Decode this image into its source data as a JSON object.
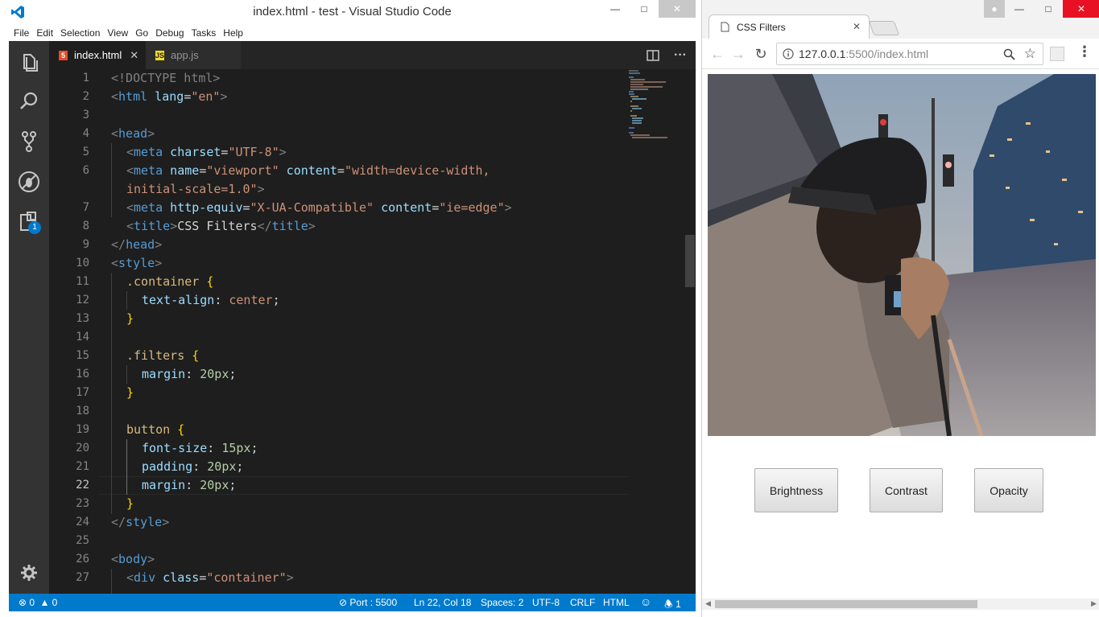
{
  "vscode": {
    "title": "index.html - test - Visual Studio Code",
    "menu": [
      "File",
      "Edit",
      "Selection",
      "View",
      "Go",
      "Debug",
      "Tasks",
      "Help"
    ],
    "tabs": [
      {
        "label": "index.html",
        "icon": "html5-icon",
        "active": true
      },
      {
        "label": "app.js",
        "icon": "js-icon",
        "active": false
      }
    ],
    "extensions_badge": "1",
    "line_numbers": [
      "1",
      "2",
      "3",
      "4",
      "5",
      "6",
      "7",
      "8",
      "9",
      "10",
      "11",
      "12",
      "13",
      "14",
      "15",
      "16",
      "17",
      "18",
      "19",
      "20",
      "21",
      "22",
      "23",
      "24",
      "25",
      "26",
      "27"
    ],
    "current_line": "22",
    "code": {
      "l1a": "<!DOCTYPE html>",
      "l2a": "<",
      "l2b": "html",
      "l2c": " lang",
      "l2d": "=",
      "l2e": "\"en\"",
      "l2f": ">",
      "l4a": "<",
      "l4b": "head",
      "l4c": ">",
      "l5a": "<",
      "l5b": "meta",
      "l5c": " charset",
      "l5d": "=",
      "l5e": "\"UTF-8\"",
      "l5f": ">",
      "l6a": "<",
      "l6b": "meta",
      "l6c": " name",
      "l6d": "=",
      "l6e": "\"viewport\"",
      "l6g": " content",
      "l6h": "=",
      "l6i": "\"width=device-width,",
      "l6j": "initial-scale=1.0\"",
      "l6k": ">",
      "l7a": "<",
      "l7b": "meta",
      "l7c": " http-equiv",
      "l7d": "=",
      "l7e": "\"X-UA-Compatible\"",
      "l7g": " content",
      "l7h": "=",
      "l7i": "\"ie=edge\"",
      "l7j": ">",
      "l8a": "<",
      "l8b": "title",
      "l8c": ">",
      "l8d": "CSS Filters",
      "l8e": "</",
      "l8f": "title",
      "l8g": ">",
      "l9a": "</",
      "l9b": "head",
      "l9c": ">",
      "l10a": "<",
      "l10b": "style",
      "l10c": ">",
      "l11a": ".container",
      "l11b": " {",
      "l12a": "text-align",
      "l12b": ": ",
      "l12c": "center",
      "l12d": ";",
      "l13a": "}",
      "l15a": ".filters",
      "l15b": " {",
      "l16a": "margin",
      "l16b": ": ",
      "l16c": "20px",
      "l16d": ";",
      "l17a": "}",
      "l19a": "button",
      "l19b": " {",
      "l20a": "font-size",
      "l20b": ": ",
      "l20c": "15px",
      "l20d": ";",
      "l21a": "padding",
      "l21b": ": ",
      "l21c": "20px",
      "l21d": ";",
      "l22a": "margin",
      "l22b": ": ",
      "l22c": "20px",
      "l22d": ";",
      "l23a": "}",
      "l24a": "</",
      "l24b": "style",
      "l24c": ">",
      "l26a": "<",
      "l26b": "body",
      "l26c": ">",
      "l27a": "<",
      "l27b": "div",
      "l27c": " class",
      "l27d": "=",
      "l27e": "\"container\"",
      "l27f": ">"
    },
    "status": {
      "errors": "0",
      "warnings": "0",
      "port": "Port : 5500",
      "position": "Ln 22, Col 18",
      "spaces": "Spaces: 2",
      "encoding": "UTF-8",
      "eol": "CRLF",
      "language": "HTML",
      "notifications": "1"
    }
  },
  "browser": {
    "tab_title": "CSS Filters",
    "url_host": "127.0.0.1",
    "url_rest": ":5500/index.html",
    "buttons": [
      "Brightness",
      "Contrast",
      "Opacity"
    ]
  },
  "colors": {
    "status_blue": "#007acc",
    "close_red": "#e81123",
    "editor_bg": "#1e1e1e"
  }
}
